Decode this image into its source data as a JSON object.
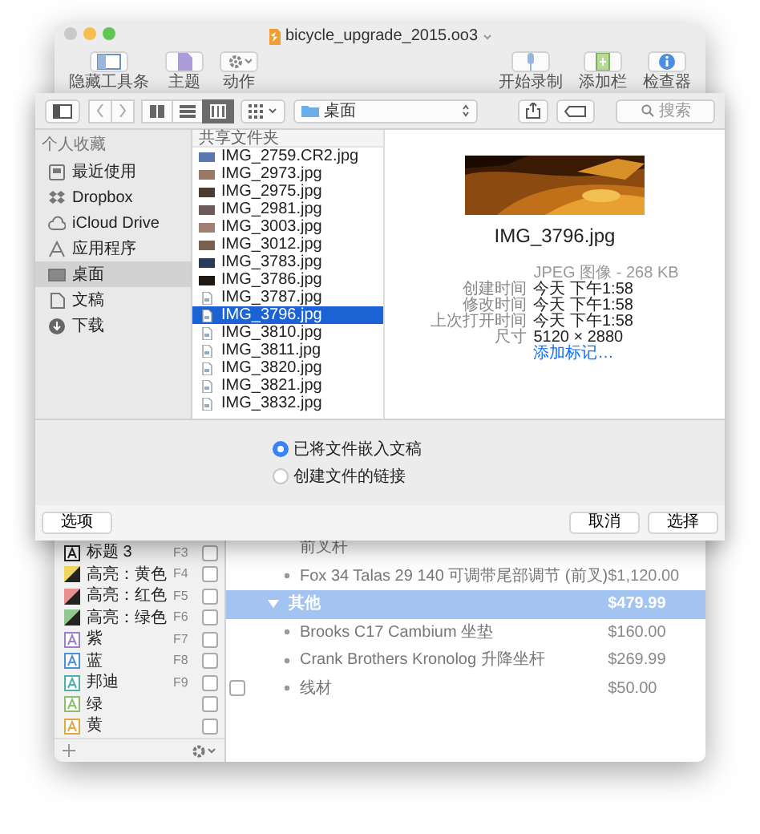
{
  "window": {
    "title": "bicycle_upgrade_2015.oo3"
  },
  "toolbar": {
    "left": [
      {
        "label": "隐藏工具条",
        "kind": "sidebar"
      },
      {
        "label": "主题",
        "kind": "theme"
      },
      {
        "label": "动作",
        "kind": "gear"
      }
    ],
    "right": [
      {
        "label": "开始录制",
        "kind": "mic"
      },
      {
        "label": "添加栏",
        "kind": "column"
      },
      {
        "label": "检查器",
        "kind": "info"
      }
    ]
  },
  "sheet": {
    "toolbar": {
      "view_modes": [
        {
          "kind": "icons",
          "selected": false
        },
        {
          "kind": "list",
          "selected": false
        },
        {
          "kind": "columns",
          "selected": true
        }
      ],
      "location": "桌面",
      "search": {
        "placeholder": "搜索"
      }
    },
    "sidebar": {
      "heading": "个人收藏",
      "items": [
        {
          "label": "最近使用",
          "kind": "recent",
          "selected": false
        },
        {
          "label": "Dropbox",
          "kind": "dropbox",
          "selected": false
        },
        {
          "label": "iCloud Drive",
          "kind": "cloud",
          "selected": false
        },
        {
          "label": "应用程序",
          "kind": "apps",
          "selected": false
        },
        {
          "label": "桌面",
          "kind": "desktop",
          "selected": true
        },
        {
          "label": "文稿",
          "kind": "documents",
          "selected": false
        },
        {
          "label": "下载",
          "kind": "downloads",
          "selected": false
        }
      ]
    },
    "column": {
      "heading": "共享文件夹",
      "files": [
        {
          "name": "IMG_2759.CR2.jpg",
          "kind": "thumb",
          "color": "#5a78b0",
          "selected": false
        },
        {
          "name": "IMG_2973.jpg",
          "kind": "thumb",
          "color": "#9a7868",
          "selected": false
        },
        {
          "name": "IMG_2975.jpg",
          "kind": "thumb",
          "color": "#4a3a30",
          "selected": false
        },
        {
          "name": "IMG_2981.jpg",
          "kind": "thumb",
          "color": "#6a5a5a",
          "selected": false
        },
        {
          "name": "IMG_3003.jpg",
          "kind": "thumb",
          "color": "#a08070",
          "selected": false
        },
        {
          "name": "IMG_3012.jpg",
          "kind": "thumb",
          "color": "#7a6050",
          "selected": false
        },
        {
          "name": "IMG_3783.jpg",
          "kind": "thumb",
          "color": "#2a3a5a",
          "selected": false
        },
        {
          "name": "IMG_3786.jpg",
          "kind": "thumb",
          "color": "#201810",
          "selected": false
        },
        {
          "name": "IMG_3787.jpg",
          "kind": "generic",
          "selected": false
        },
        {
          "name": "IMG_3796.jpg",
          "kind": "generic",
          "selected": true
        },
        {
          "name": "IMG_3810.jpg",
          "kind": "generic",
          "selected": false
        },
        {
          "name": "IMG_3811.jpg",
          "kind": "generic",
          "selected": false
        },
        {
          "name": "IMG_3820.jpg",
          "kind": "generic",
          "selected": false
        },
        {
          "name": "IMG_3821.jpg",
          "kind": "generic",
          "selected": false
        },
        {
          "name": "IMG_3832.jpg",
          "kind": "generic",
          "selected": false
        }
      ]
    },
    "preview": {
      "kind": "picture",
      "name": "IMG_3796.jpg",
      "type_line": "JPEG 图像 - 268 KB",
      "details": [
        {
          "key": "创建时间",
          "value": "今天 下午1:58"
        },
        {
          "key": "修改时间",
          "value": "今天 下午1:58"
        },
        {
          "key": "上次打开时间",
          "value": "今天 下午1:58"
        },
        {
          "key": "尺寸",
          "value": "5120 × 2880"
        }
      ],
      "link": "添加标记…"
    },
    "options": [
      {
        "label": "已将文件嵌入文稿",
        "selected": true
      },
      {
        "label": "创建文件的链接",
        "selected": false
      }
    ],
    "buttons": {
      "left": "选项",
      "right": [
        "取消",
        "选择"
      ]
    }
  },
  "styles": [
    {
      "name": "标题 3",
      "shortcut": "F3",
      "kind": "letter",
      "color": "#222222",
      "checked": false
    },
    {
      "name": "高亮：黄色",
      "shortcut": "F4",
      "kind": "highlight",
      "color": "#f0d860",
      "checked": false
    },
    {
      "name": "高亮：红色",
      "shortcut": "F5",
      "kind": "highlight",
      "color": "#e89090",
      "checked": false
    },
    {
      "name": "高亮：绿色",
      "shortcut": "F6",
      "kind": "highlight",
      "color": "#90c890",
      "checked": false
    },
    {
      "name": "紫",
      "shortcut": "F7",
      "kind": "letter",
      "color": "#9a7fd0",
      "checked": false
    },
    {
      "name": "蓝",
      "shortcut": "F8",
      "kind": "letter",
      "color": "#4a8fd8",
      "checked": false
    },
    {
      "name": "邦迪",
      "shortcut": "F9",
      "kind": "letter",
      "color": "#4ab0b0",
      "checked": false
    },
    {
      "name": "绿",
      "kind": "letter",
      "color": "#8bbf6a",
      "checked": false
    },
    {
      "name": "黄",
      "kind": "letter",
      "color": "#e0a840",
      "checked": false
    }
  ],
  "outline": {
    "rows": [
      {
        "kind": "continuation",
        "text": "前叉杆",
        "selected": false
      },
      {
        "kind": "item",
        "text": "Fox 34 Talas 29 140 可调带尾部调节 (前叉)",
        "price": "$1,120.00",
        "selected": false
      },
      {
        "kind": "group",
        "text": "其他",
        "price": "$479.99",
        "selected": true,
        "expanded": true,
        "children": [
          {
            "kind": "item",
            "text": "Brooks C17 Cambium 坐垫",
            "price": "$160.00",
            "selected": false
          },
          {
            "kind": "item",
            "text": "Crank Brothers Kronolog 升降坐杆",
            "price": "$269.99",
            "selected": false
          },
          {
            "kind": "item",
            "text": "线材",
            "price": "$50.00",
            "selected": false,
            "checked": false
          }
        ]
      }
    ]
  }
}
